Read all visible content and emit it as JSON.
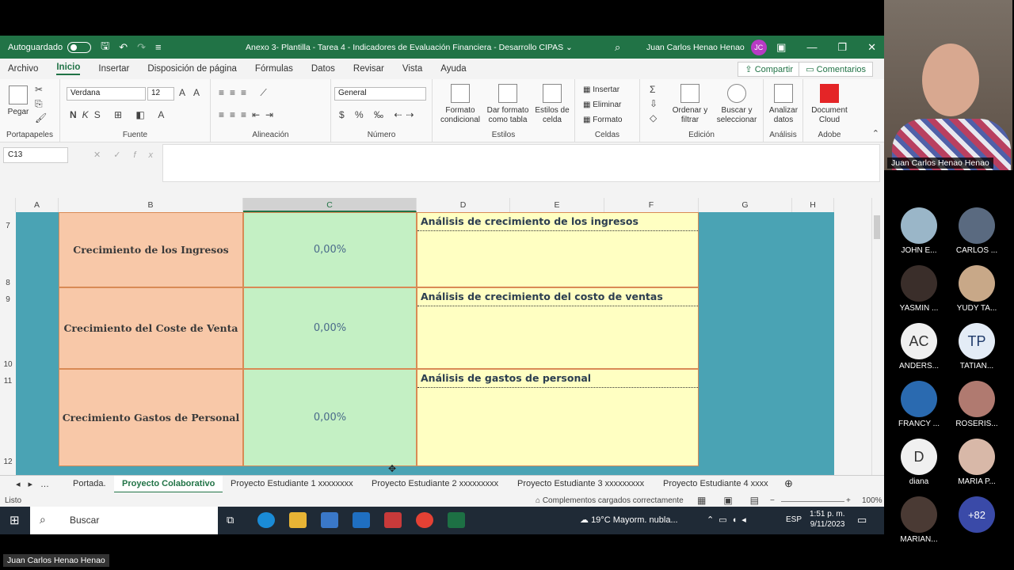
{
  "titlebar": {
    "autosave_label": "Autoguardado",
    "doc_title": "Anexo 3- Plantilla - Tarea 4 - Indicadores de Evaluación Financiera - Desarrollo CIPAS  ⌄",
    "user_name": "Juan Carlos Henao Henao",
    "user_initials": "JC"
  },
  "menu": {
    "tabs": [
      "Archivo",
      "Inicio",
      "Insertar",
      "Disposición de página",
      "Fórmulas",
      "Datos",
      "Revisar",
      "Vista",
      "Ayuda"
    ],
    "share": "Compartir",
    "comments": "Comentarios"
  },
  "ribbon": {
    "paste": "Pegar",
    "font_name": "Verdana",
    "font_size": "12",
    "number_format": "General",
    "cond_format": "Formato condicional",
    "table_format": "Dar formato como tabla",
    "cell_styles": "Estilos de celda",
    "insert": "Insertar",
    "delete": "Eliminar",
    "format": "Formato",
    "sort": "Ordenar y filtrar",
    "find": "Buscar y seleccionar",
    "analyze": "Analizar datos",
    "doc_cloud": "Document Cloud",
    "groups": {
      "portapapeles": "Portapapeles",
      "fuente": "Fuente",
      "alineacion": "Alineación",
      "numero": "Número",
      "estilos": "Estilos",
      "celdas": "Celdas",
      "edicion": "Edición",
      "analisis": "Análisis",
      "adobe": "Adobe"
    }
  },
  "formula": {
    "namebox": "C13",
    "fx": "fx"
  },
  "columns": [
    "A",
    "B",
    "C",
    "D",
    "E",
    "F",
    "G",
    "H"
  ],
  "rows": [
    "7",
    "8",
    "9",
    "10",
    "11",
    "12"
  ],
  "blocks": [
    {
      "label": "Crecimiento de los Ingresos",
      "value": "0,00%",
      "analysis": "Análisis de crecimiento de los ingresos"
    },
    {
      "label": "Crecimiento del Coste de Venta",
      "value": "0,00%",
      "analysis": "Análisis de crecimiento del costo de ventas"
    },
    {
      "label": "Crecimiento Gastos de Personal",
      "value": "0,00%",
      "analysis": "Análisis de gastos de personal"
    }
  ],
  "sheets": [
    "Portada.",
    "Proyecto Colaborativo",
    "Proyecto Estudiante 1 xxxxxxxx",
    "Proyecto Estudiante 2 xxxxxxxxx",
    "Proyecto Estudiante 3 xxxxxxxxx",
    "Proyecto Estudiante 4 xxxx"
  ],
  "status": {
    "ready": "Listo",
    "addins": "Complementos cargados correctamente",
    "zoom": "100%"
  },
  "taskbar": {
    "search": "Buscar",
    "weather": "19°C  Mayorm. nubla...",
    "lang": "ESP",
    "time": "1:51 p. m.",
    "date": "9/11/2023"
  },
  "participants": [
    {
      "name": "JOHN E...",
      "initials": ""
    },
    {
      "name": "CARLOS ...",
      "initials": ""
    },
    {
      "name": "YASMIN ...",
      "initials": ""
    },
    {
      "name": "YUDY TA...",
      "initials": ""
    },
    {
      "name": "ANDERS...",
      "initials": "AC"
    },
    {
      "name": "TATIAN...",
      "initials": "TP"
    },
    {
      "name": "FRANCY ...",
      "initials": ""
    },
    {
      "name": "ROSERIS...",
      "initials": ""
    },
    {
      "name": "diana",
      "initials": "D"
    },
    {
      "name": "MARIA P...",
      "initials": ""
    },
    {
      "name": "MARIAN...",
      "initials": ""
    },
    {
      "name": "",
      "initials": "+82"
    }
  ],
  "video_name": "Juan Carlos Henao Henao",
  "presenter_name": "Juan Carlos Henao Henao",
  "colors": {
    "excel_green": "#217346",
    "sheet_bg": "#4aa3b4",
    "label_fill": "#f8c8a8",
    "value_fill": "#c4f0c4",
    "analysis_fill": "#ffffc2"
  }
}
